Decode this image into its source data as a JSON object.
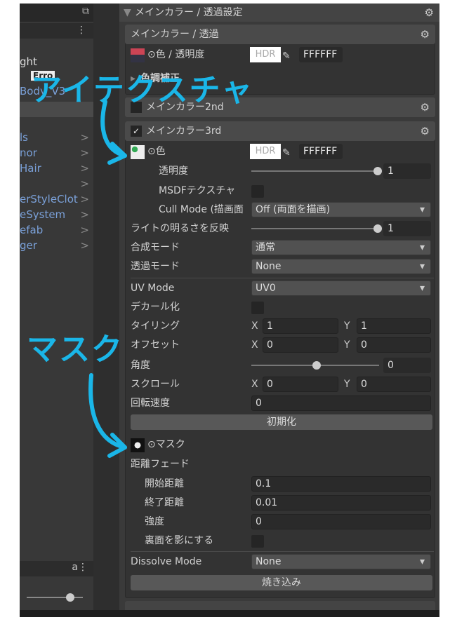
{
  "left_panel": {
    "items_top": [
      "ght",
      "Erro",
      "Body_V3"
    ],
    "items": [
      "ls",
      "nor",
      "Hair",
      "",
      "erStyleClot",
      "eSystem",
      "efab",
      "ger"
    ]
  },
  "inspector": {
    "section_title": "メインカラー / 透過設定",
    "main_color": {
      "title": "メインカラー / 透過",
      "color_label": "⊙色 / 透明度",
      "hdr": "HDR",
      "hex": "FFFFFF",
      "color_adjust": "色調補正"
    },
    "main2nd": {
      "title": "メインカラー2nd",
      "checked": false
    },
    "main3rd": {
      "title": "メインカラー3rd",
      "checked": true,
      "color_label": "⊙色",
      "hdr": "HDR",
      "hex": "FFFFFF",
      "opacity_label": "透明度",
      "opacity_value": "1",
      "opacity_fraction": 1.0,
      "msdf_label": "MSDFテクスチャ",
      "cull_label": "Cull Mode (描画面",
      "cull_value": "Off (両面を描画)",
      "light_label": "ライトの明るさを反映",
      "light_value": "1",
      "light_fraction": 1.0,
      "blend_label": "合成モード",
      "blend_value": "通常",
      "alpha_label": "透過モード",
      "alpha_value": "None",
      "uv_label": "UV Mode",
      "uv_value": "UV0",
      "decal_label": "デカール化",
      "tiling_label": "タイリング",
      "tiling_x": "1",
      "tiling_y": "1",
      "offset_label": "オフセット",
      "offset_x": "0",
      "offset_y": "0",
      "angle_label": "角度",
      "angle_value": "0",
      "angle_fraction": 0.5,
      "scroll_label": "スクロール",
      "scroll_x": "0",
      "scroll_y": "0",
      "rotate_label": "回転速度",
      "rotate_value": "0",
      "reset_button": "初期化",
      "mask_label": "⊙マスク",
      "fade_label": "距離フェード",
      "fade_start_label": "開始距離",
      "fade_start": "0.1",
      "fade_end_label": "終了距離",
      "fade_end": "0.01",
      "strength_label": "強度",
      "strength": "0",
      "backface_label": "裏面を影にする",
      "dissolve_label": "Dissolve Mode",
      "dissolve_value": "None",
      "bake_button": "焼き込み"
    },
    "x_label": "X",
    "y_label": "Y"
  },
  "annotations": {
    "texture": "アイテクスチャ",
    "mask": "マスク"
  },
  "colors": {
    "annotation": "#1ab6e8"
  }
}
